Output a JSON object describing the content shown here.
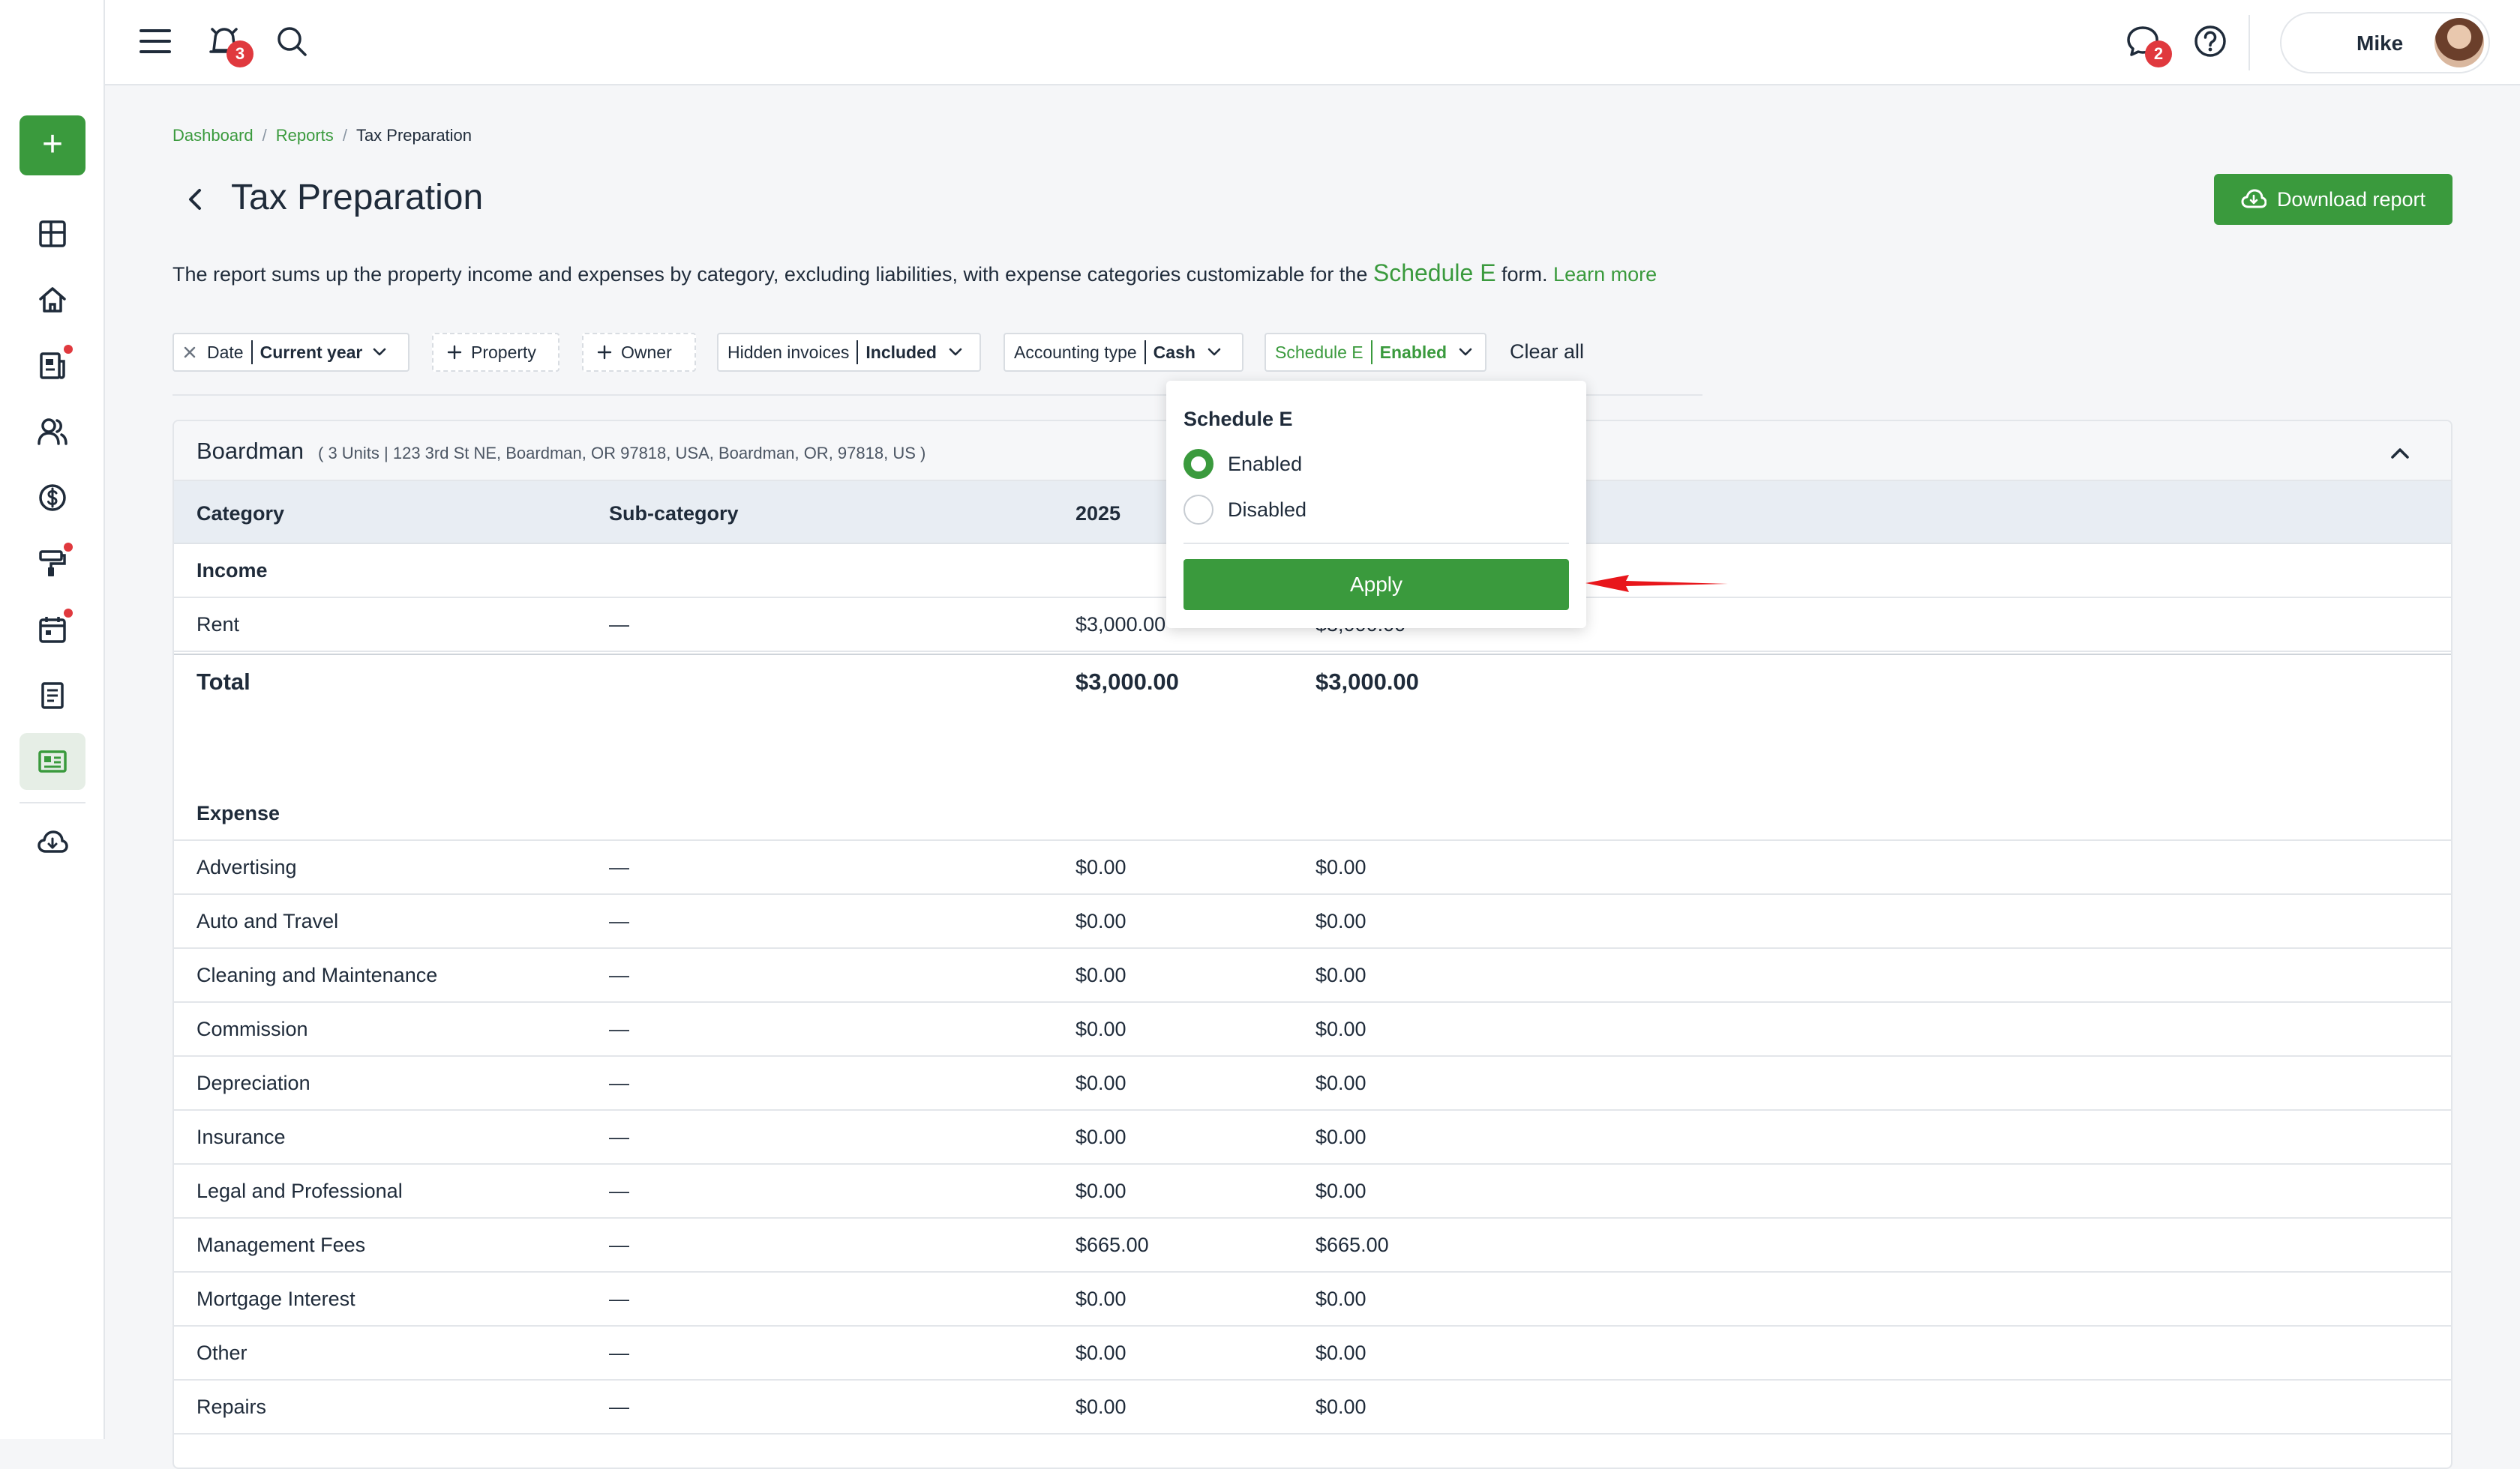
{
  "topbar": {
    "notifications_count": "3",
    "messages_count": "2",
    "user_name": "Mike"
  },
  "sidebar": {
    "add_label": "+",
    "items": [
      {
        "icon": "dashboard-icon"
      },
      {
        "icon": "home-icon"
      },
      {
        "icon": "leases-icon",
        "dot": true
      },
      {
        "icon": "people-icon"
      },
      {
        "icon": "dollar-icon"
      },
      {
        "icon": "maintenance-icon",
        "dot": true
      },
      {
        "icon": "calendar-icon",
        "dot": true
      },
      {
        "icon": "documents-icon"
      },
      {
        "icon": "reports-icon",
        "active": true
      },
      {
        "icon": "download-cloud-icon"
      }
    ]
  },
  "breadcrumb": {
    "items": [
      "Dashboard",
      "Reports"
    ],
    "current": "Tax Preparation",
    "separator": "/"
  },
  "page": {
    "title": "Tax Preparation",
    "download_label": "Download report",
    "description_start": "The report sums up the property income and expenses by category, excluding liabilities, with expense categories customizable for the ",
    "description_link": "Schedule E",
    "description_end": " form. ",
    "learn_more": "Learn more"
  },
  "filters": {
    "date_label": "Date",
    "date_value": "Current year",
    "property_label": "Property",
    "owner_label": "Owner",
    "hidden_label": "Hidden invoices",
    "hidden_value": "Included",
    "accounting_label": "Accounting type",
    "accounting_value": "Cash",
    "schedule_label": "Schedule E",
    "schedule_value": "Enabled",
    "clear_all": "Clear all"
  },
  "popover": {
    "title": "Schedule E",
    "options": [
      "Enabled",
      "Disabled"
    ],
    "selected": "Enabled",
    "apply_label": "Apply"
  },
  "report": {
    "property_name": "Boardman",
    "property_address": "( 3 Units | 123 3rd St NE, Boardman, OR 97818, USA, Boardman, OR, 97818, US )",
    "columns": [
      "Category",
      "Sub-category",
      "2025",
      ""
    ],
    "income_label": "Income",
    "income_rows": [
      {
        "category": "Rent",
        "sub": "—",
        "year": "$3,000.00",
        "total": "$3,000.00"
      }
    ],
    "total_label": "Total",
    "total_year": "$3,000.00",
    "total_total": "$3,000.00",
    "expense_label": "Expense",
    "expense_rows": [
      {
        "category": "Advertising",
        "sub": "—",
        "year": "$0.00",
        "total": "$0.00"
      },
      {
        "category": "Auto and Travel",
        "sub": "—",
        "year": "$0.00",
        "total": "$0.00"
      },
      {
        "category": "Cleaning and Maintenance",
        "sub": "—",
        "year": "$0.00",
        "total": "$0.00"
      },
      {
        "category": "Commission",
        "sub": "—",
        "year": "$0.00",
        "total": "$0.00"
      },
      {
        "category": "Depreciation",
        "sub": "—",
        "year": "$0.00",
        "total": "$0.00"
      },
      {
        "category": "Insurance",
        "sub": "—",
        "year": "$0.00",
        "total": "$0.00"
      },
      {
        "category": "Legal and Professional",
        "sub": "—",
        "year": "$0.00",
        "total": "$0.00"
      },
      {
        "category": "Management Fees",
        "sub": "—",
        "year": "$665.00",
        "total": "$665.00"
      },
      {
        "category": "Mortgage Interest",
        "sub": "—",
        "year": "$0.00",
        "total": "$0.00"
      },
      {
        "category": "Other",
        "sub": "—",
        "year": "$0.00",
        "total": "$0.00"
      },
      {
        "category": "Repairs",
        "sub": "—",
        "year": "$0.00",
        "total": "$0.00"
      }
    ]
  },
  "colors": {
    "accent": "#3a9a3d",
    "badge": "#e0393e",
    "annotation_arrow": "#e8161b"
  }
}
